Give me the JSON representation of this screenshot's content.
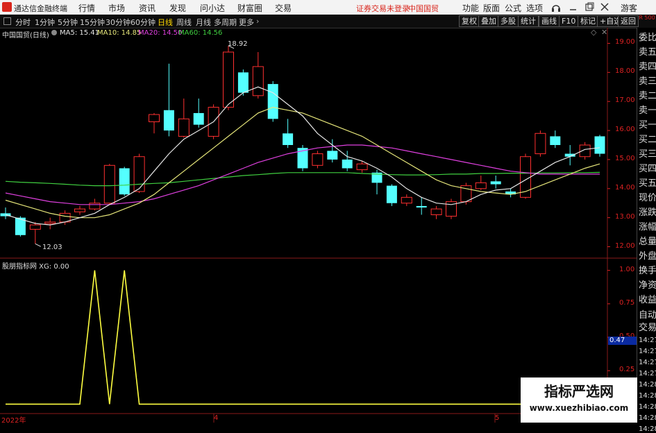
{
  "app": {
    "name": "通达信金融终端"
  },
  "menu": [
    "行情",
    "市场",
    "资讯",
    "发现",
    "问小达",
    "财富圈",
    "交易"
  ],
  "status": {
    "warning": "证券交易未登录",
    "stock_name": "中国国贸"
  },
  "right_menu": [
    "功能",
    "版面",
    "公式",
    "选项"
  ],
  "guest": "游客",
  "toolbar": {
    "periods": [
      "分时",
      "1分钟",
      "5分钟",
      "15分钟",
      "30分钟",
      "60分钟",
      "日线",
      "周线",
      "月线",
      "多周期",
      "更多"
    ],
    "active": "日线",
    "buttons": [
      "复权",
      "叠加",
      "多股",
      "统计",
      "画线",
      "F10",
      "标记",
      "+自选",
      "返回"
    ]
  },
  "chart_title": "中国国贸(日线)",
  "ma_legend": [
    {
      "label": "MA5: 15.41",
      "color": "#e6e6e6"
    },
    {
      "label": "MA10: 14.85",
      "color": "#e6e67a"
    },
    {
      "label": "MA20: 14.50",
      "color": "#e040e0"
    },
    {
      "label": "MA60: 14.56",
      "color": "#40d040"
    }
  ],
  "indicator_title": "股朋指标网 XG: 0.00",
  "high_label": "18.92",
  "low_label": "12.03",
  "current_value": "0.47",
  "x_labels": [
    "2022年",
    "4",
    "5"
  ],
  "right_panel": {
    "top_label": "R 500",
    "items": [
      "委比",
      "卖五",
      "卖四",
      "卖三",
      "卖二",
      "卖一",
      "买一",
      "买二",
      "买三",
      "买四",
      "买五",
      "现价",
      "涨跌",
      "涨幅",
      "总量",
      "外盘",
      "换手",
      "净资",
      "收益"
    ],
    "lower_items": [
      "自动",
      "交易"
    ],
    "times": [
      "14:27",
      "14:27",
      "14:27",
      "14:27",
      "14:28",
      "14:28",
      "14:28",
      "14:28",
      "14:28"
    ]
  },
  "watermark": {
    "line1": "指标严选网",
    "line2": "www.xuezhibiao.com"
  },
  "chart_data": [
    {
      "type": "candlestick",
      "y_ticks": [
        12.0,
        13.0,
        14.0,
        15.0,
        16.0,
        17.0,
        18.0,
        19.0
      ],
      "ylim": [
        11.75,
        19.25
      ],
      "candles": [
        {
          "o": 13.15,
          "c": 13.05,
          "h": 13.35,
          "l": 12.95
        },
        {
          "o": 13.0,
          "c": 12.4,
          "h": 13.05,
          "l": 12.35
        },
        {
          "o": 12.6,
          "c": 12.75,
          "h": 12.85,
          "l": 12.1
        },
        {
          "o": 12.8,
          "c": 12.85,
          "h": 13.0,
          "l": 12.6
        },
        {
          "o": 12.85,
          "c": 13.15,
          "h": 13.25,
          "l": 12.75
        },
        {
          "o": 13.2,
          "c": 13.3,
          "h": 13.4,
          "l": 13.1
        },
        {
          "o": 13.3,
          "c": 13.5,
          "h": 13.65,
          "l": 13.25
        },
        {
          "o": 13.5,
          "c": 14.8,
          "h": 14.85,
          "l": 13.45
        },
        {
          "o": 14.7,
          "c": 13.8,
          "h": 14.75,
          "l": 13.75
        },
        {
          "o": 13.9,
          "c": 15.1,
          "h": 15.2,
          "l": 13.85
        },
        {
          "o": 16.3,
          "c": 16.55,
          "h": 16.6,
          "l": 15.9
        },
        {
          "o": 16.7,
          "c": 16.0,
          "h": 18.3,
          "l": 15.8
        },
        {
          "o": 15.8,
          "c": 16.4,
          "h": 17.1,
          "l": 15.75
        },
        {
          "o": 16.6,
          "c": 16.2,
          "h": 17.1,
          "l": 16.1
        },
        {
          "o": 15.8,
          "c": 16.8,
          "h": 16.9,
          "l": 15.7
        },
        {
          "o": 16.8,
          "c": 18.7,
          "h": 18.92,
          "l": 16.7
        },
        {
          "o": 18.0,
          "c": 17.3,
          "h": 18.1,
          "l": 17.2
        },
        {
          "o": 17.2,
          "c": 18.2,
          "h": 18.7,
          "l": 17.1
        },
        {
          "o": 17.6,
          "c": 16.4,
          "h": 17.7,
          "l": 16.3
        },
        {
          "o": 15.9,
          "c": 15.5,
          "h": 16.4,
          "l": 15.4
        },
        {
          "o": 15.4,
          "c": 14.7,
          "h": 15.5,
          "l": 14.6
        },
        {
          "o": 14.8,
          "c": 15.2,
          "h": 15.3,
          "l": 14.7
        },
        {
          "o": 15.3,
          "c": 15.0,
          "h": 15.7,
          "l": 14.9
        },
        {
          "o": 15.0,
          "c": 14.7,
          "h": 15.3,
          "l": 14.6
        },
        {
          "o": 14.65,
          "c": 14.85,
          "h": 14.95,
          "l": 14.55
        },
        {
          "o": 14.55,
          "c": 14.2,
          "h": 14.65,
          "l": 13.8
        },
        {
          "o": 14.1,
          "c": 13.5,
          "h": 14.15,
          "l": 13.4
        },
        {
          "o": 13.5,
          "c": 13.7,
          "h": 13.8,
          "l": 13.4
        },
        {
          "o": 13.4,
          "c": 13.35,
          "h": 13.7,
          "l": 13.1
        },
        {
          "o": 13.1,
          "c": 13.3,
          "h": 13.4,
          "l": 12.95
        },
        {
          "o": 13.05,
          "c": 13.55,
          "h": 13.65,
          "l": 12.95
        },
        {
          "o": 13.55,
          "c": 14.1,
          "h": 14.2,
          "l": 13.45
        },
        {
          "o": 14.0,
          "c": 14.2,
          "h": 14.45,
          "l": 13.95
        },
        {
          "o": 14.25,
          "c": 14.15,
          "h": 14.45,
          "l": 14.0
        },
        {
          "o": 13.9,
          "c": 13.8,
          "h": 14.0,
          "l": 13.7
        },
        {
          "o": 13.7,
          "c": 15.1,
          "h": 15.2,
          "l": 13.65
        },
        {
          "o": 15.2,
          "c": 15.9,
          "h": 16.0,
          "l": 15.1
        },
        {
          "o": 15.8,
          "c": 15.5,
          "h": 16.0,
          "l": 15.4
        },
        {
          "o": 15.2,
          "c": 15.1,
          "h": 15.5,
          "l": 14.8
        },
        {
          "o": 15.1,
          "c": 15.5,
          "h": 15.6,
          "l": 15.0
        },
        {
          "o": 15.8,
          "c": 15.2,
          "h": 15.85,
          "l": 15.1
        }
      ],
      "ma5": [
        13.1,
        12.95,
        12.8,
        12.75,
        12.85,
        13.0,
        13.15,
        13.45,
        13.7,
        14.0,
        14.6,
        15.2,
        15.7,
        16.0,
        16.3,
        16.9,
        17.3,
        17.5,
        17.3,
        16.9,
        16.5,
        15.9,
        15.5,
        15.1,
        14.95,
        14.7,
        14.4,
        14.0,
        13.7,
        13.5,
        13.45,
        13.55,
        13.8,
        13.95,
        14.0,
        14.3,
        14.6,
        14.9,
        15.1,
        15.35,
        15.41
      ],
      "ma10": [
        13.6,
        13.45,
        13.3,
        13.15,
        13.05,
        13.0,
        13.0,
        13.1,
        13.3,
        13.5,
        13.8,
        14.2,
        14.6,
        15.0,
        15.4,
        15.8,
        16.2,
        16.6,
        16.8,
        16.7,
        16.6,
        16.4,
        16.2,
        16.0,
        15.8,
        15.5,
        15.2,
        14.9,
        14.6,
        14.3,
        14.1,
        14.0,
        13.9,
        13.85,
        13.8,
        13.9,
        14.1,
        14.3,
        14.5,
        14.7,
        14.85
      ],
      "ma20": [
        13.85,
        13.75,
        13.65,
        13.55,
        13.5,
        13.45,
        13.45,
        13.45,
        13.5,
        13.55,
        13.65,
        13.8,
        13.95,
        14.1,
        14.3,
        14.5,
        14.7,
        14.9,
        15.05,
        15.2,
        15.3,
        15.4,
        15.45,
        15.5,
        15.5,
        15.45,
        15.4,
        15.3,
        15.2,
        15.1,
        15.0,
        14.9,
        14.8,
        14.7,
        14.6,
        14.55,
        14.5,
        14.5,
        14.5,
        14.5,
        14.5
      ],
      "ma60": [
        14.25,
        14.22,
        14.2,
        14.18,
        14.15,
        14.12,
        14.1,
        14.1,
        14.12,
        14.15,
        14.18,
        14.2,
        14.25,
        14.3,
        14.35,
        14.4,
        14.45,
        14.48,
        14.52,
        14.55,
        14.55,
        14.55,
        14.55,
        14.55,
        14.52,
        14.5,
        14.48,
        14.47,
        14.47,
        14.48,
        14.5,
        14.5,
        14.52,
        14.52,
        14.53,
        14.53,
        14.54,
        14.54,
        14.55,
        14.55,
        14.56
      ]
    },
    {
      "type": "line",
      "title": "股朋指标网",
      "y_ticks": [
        0.0,
        0.25,
        0.5,
        0.75,
        1.0
      ],
      "ylim": [
        -0.05,
        1.05
      ],
      "series": [
        {
          "name": "XG",
          "values": [
            0,
            0,
            0,
            0,
            0,
            0,
            1,
            0,
            1,
            0,
            0,
            0,
            0,
            0,
            0,
            0,
            0,
            0,
            0,
            0,
            0,
            0,
            0,
            0,
            0,
            0,
            0,
            0,
            0,
            0,
            0,
            0,
            0,
            0,
            0,
            0,
            0,
            0,
            0,
            0,
            0
          ]
        }
      ]
    }
  ]
}
